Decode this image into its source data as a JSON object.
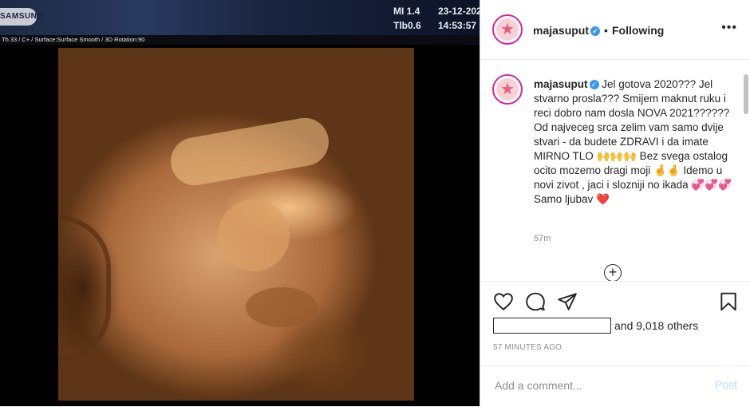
{
  "ultrasound": {
    "brand": "SAMSUNG",
    "mi_label": "MI 1.4",
    "tib_label": "Tlb0.6",
    "date": "23-12-202",
    "time": "14:53:57",
    "params": "Th 33 / C+ / Surface:Surface Smooth / 3D Rotation:90"
  },
  "post": {
    "username": "majasuput",
    "follow_status": "Following",
    "more_icon": "more-horizontal-icon",
    "caption_text": "Jel gotova 2020??? Jel stvarno prosla??? Smijem maknut ruku i reci dobro nam dosla NOVA 2021??????\nOd najveceg srca zelim vam samo dvije stvari - da budete ZDRAVI i da imate MIRNO TLO 🙌🙌🙌 Bez svega ostalog ocito mozemo dragi moji 🤞🤞 Idemo u novi zivot , jaci i slozniji no ikada 💞💞💞 Samo ljubav ❤️",
    "caption_age": "57m",
    "likes_text": "and 9,018 others",
    "timestamp": "57 MINUTES AGO",
    "comment_placeholder": "Add a comment...",
    "post_label": "Post"
  },
  "colors": {
    "verified": "#3897f0",
    "post_disabled": "#b2dffc",
    "avatar_ring": "#d6249f"
  }
}
